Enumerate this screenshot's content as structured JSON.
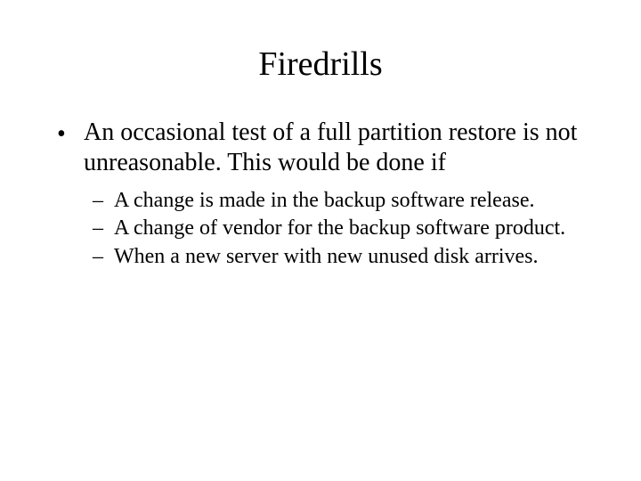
{
  "title": "Firedrills",
  "bullets": [
    {
      "text": "An occasional test of a full partition restore is not unreasonable. This would be done if",
      "subs": [
        "A change is made in the backup software release.",
        "A change of vendor for the backup software product.",
        "When a new server with new unused disk arrives."
      ]
    }
  ]
}
